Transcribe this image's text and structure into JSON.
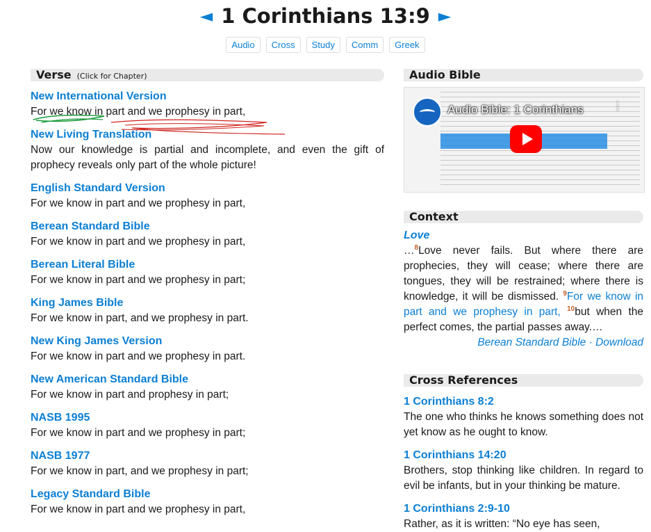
{
  "header": {
    "title": "1 Corinthians 13:9",
    "prev_arrow": "◄",
    "next_arrow": "►"
  },
  "tabs": [
    "Audio",
    "Cross",
    "Study",
    "Comm",
    "Greek"
  ],
  "verse_section": {
    "heading": "Verse",
    "subheading": "(Click for Chapter)",
    "versions": [
      {
        "name": "New International Version",
        "text": "For we know in part and we prophesy in part,"
      },
      {
        "name": "New Living Translation",
        "text": "Now our knowledge is partial and incomplete, and even the gift of prophecy reveals only part of the whole picture!"
      },
      {
        "name": "English Standard Version",
        "text": "For we know in part and we prophesy in part,"
      },
      {
        "name": "Berean Standard Bible",
        "text": "For we know in part and we prophesy in part,"
      },
      {
        "name": "Berean Literal Bible",
        "text": "For we know in part and we prophesy in part;"
      },
      {
        "name": "King James Bible",
        "text": "For we know in part, and we prophesy in part."
      },
      {
        "name": "New King James Version",
        "text": "For we know in part and we prophesy in part."
      },
      {
        "name": "New American Standard Bible",
        "text": "For we know in part and prophesy in part;"
      },
      {
        "name": "NASB 1995",
        "text": "For we know in part and we prophesy in part;"
      },
      {
        "name": "NASB 1977",
        "text": "For we know in part, and we prophesy in part;"
      },
      {
        "name": "Legacy Standard Bible",
        "text": "For we know in part and we prophesy in part,"
      }
    ]
  },
  "audio_section": {
    "heading": "Audio Bible",
    "video_title": "Audio Bible: 1 Corinthians",
    "menu_glyph": "⋮"
  },
  "context_section": {
    "heading": "Context",
    "story_title": "Love",
    "ellipsis_start": "…",
    "v8_num": "8",
    "v8_text": "Love never fails. But where there are prophecies, they will cease; where there are tongues, they will be restrained; where there is knowledge, it will be dismissed. ",
    "v9_num": "9",
    "v9_text": "For we know in part and we prophesy in part,",
    "v10_num": "10",
    "v10_text": "but when the perfect comes, the partial passes away.…",
    "attribution_version": "Berean Standard Bible",
    "attribution_sep": " · ",
    "attribution_download": "Download"
  },
  "cross_refs_section": {
    "heading": "Cross References",
    "refs": [
      {
        "ref": "1 Corinthians 8:2",
        "text": "The one who thinks he knows something does not yet know as he ought to know."
      },
      {
        "ref": "1 Corinthians 14:20",
        "text": "Brothers, stop thinking like children. In regard to evil be infants, but in your thinking be mature."
      },
      {
        "ref": "1 Corinthians 2:9-10",
        "text": "Rather, as it is written: “No eye has seen,"
      }
    ]
  },
  "colors": {
    "link": "#0b7fd4",
    "verse_number": "#c0632a",
    "section_bg": "#eaeaea",
    "play_button": "#ff0000"
  }
}
